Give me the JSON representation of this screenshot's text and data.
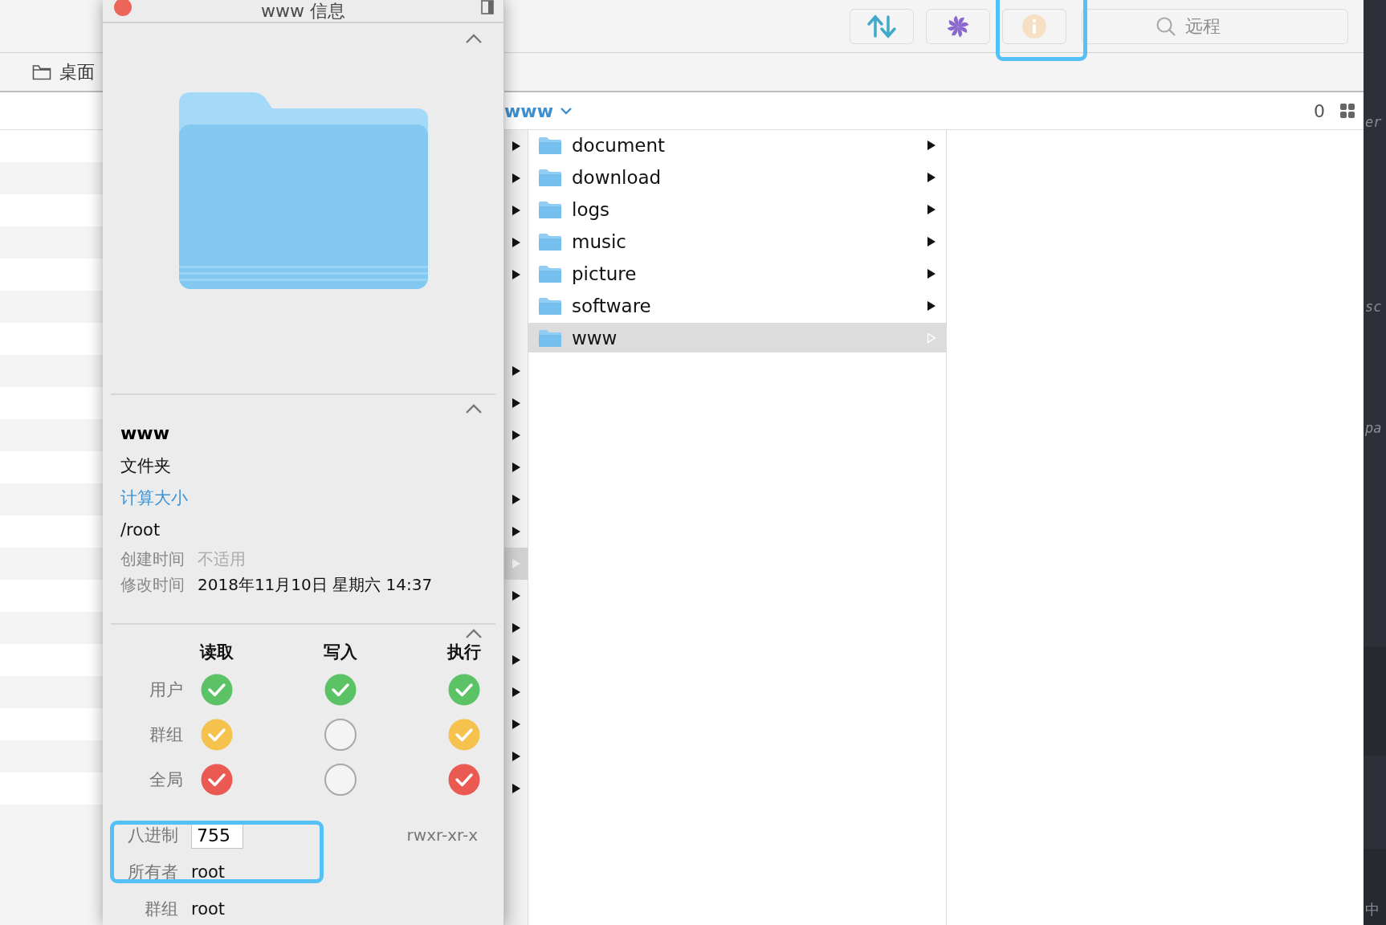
{
  "toolbar": {
    "search": {
      "placeholder": "远程"
    }
  },
  "location_bar": {
    "item": "桌面"
  },
  "path_bar": {
    "folder": "www",
    "item_count": "0"
  },
  "parent_column": {
    "rows": [
      {
        "expandable": true,
        "selected": false
      },
      {
        "expandable": true,
        "selected": false
      },
      {
        "expandable": true,
        "selected": false
      },
      {
        "expandable": true,
        "selected": false
      },
      {
        "expandable": true,
        "selected": false
      },
      {
        "expandable": false,
        "selected": false
      },
      {
        "expandable": false,
        "selected": false
      },
      {
        "expandable": true,
        "selected": false
      },
      {
        "expandable": true,
        "selected": false
      },
      {
        "expandable": true,
        "selected": false
      },
      {
        "expandable": true,
        "selected": false
      },
      {
        "expandable": true,
        "selected": false
      },
      {
        "expandable": true,
        "selected": false
      },
      {
        "expandable": true,
        "selected": true
      },
      {
        "expandable": true,
        "selected": false
      },
      {
        "expandable": true,
        "selected": false
      },
      {
        "expandable": true,
        "selected": false
      },
      {
        "expandable": true,
        "selected": false
      },
      {
        "expandable": true,
        "selected": false
      },
      {
        "expandable": true,
        "selected": false
      },
      {
        "expandable": true,
        "selected": false
      }
    ]
  },
  "folder_column": {
    "items": [
      {
        "name": "document",
        "selected": false
      },
      {
        "name": "download",
        "selected": false
      },
      {
        "name": "logs",
        "selected": false
      },
      {
        "name": "music",
        "selected": false
      },
      {
        "name": "picture",
        "selected": false
      },
      {
        "name": "software",
        "selected": false
      },
      {
        "name": "www",
        "selected": true
      }
    ]
  },
  "info_window": {
    "title": "www 信息",
    "name": "www",
    "kind": "文件夹",
    "size_link": "计算大小",
    "path": "/root",
    "details": [
      {
        "label": "创建时间",
        "value": "不适用",
        "available": false
      },
      {
        "label": "修改时间",
        "value": "2018年11月10日 星期六 14:37",
        "available": true
      }
    ],
    "permissions": {
      "columns": [
        "读取",
        "写入",
        "执行"
      ],
      "rows": [
        {
          "label": "用户",
          "color": "#5cc266",
          "cells": [
            {
              "checked": true
            },
            {
              "checked": true
            },
            {
              "checked": true
            }
          ]
        },
        {
          "label": "群组",
          "color": "#f6c24e",
          "cells": [
            {
              "checked": true
            },
            {
              "checked": false
            },
            {
              "checked": true
            }
          ]
        },
        {
          "label": "全局",
          "color": "#eb5a52",
          "cells": [
            {
              "checked": true
            },
            {
              "checked": false
            },
            {
              "checked": true
            }
          ]
        }
      ]
    },
    "octal": {
      "label": "八进制",
      "value": "755"
    },
    "symbolic": "rwxr-xr-x",
    "owner": {
      "label": "所有者",
      "value": "root"
    },
    "group": {
      "label": "群组",
      "value": "root"
    }
  },
  "editor_fragments": [
    "er",
    "sc",
    "pa",
    "中"
  ]
}
